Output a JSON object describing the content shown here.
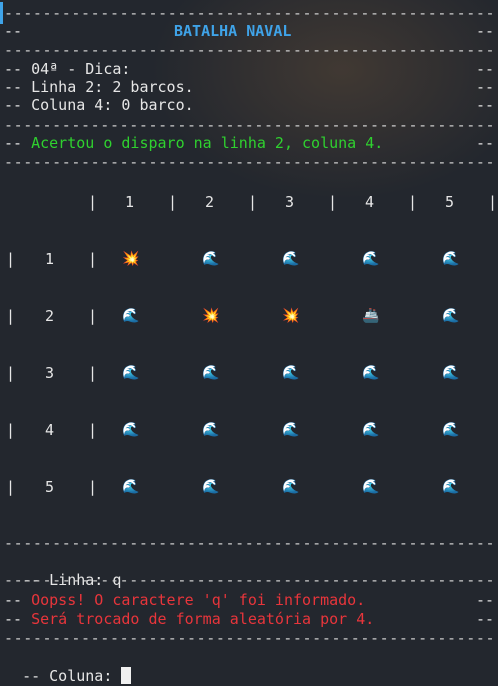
{
  "header": {
    "dash": "--------------------------------------------------------------------",
    "edge": "--",
    "title": "BATALHA NAVAL"
  },
  "hint": {
    "title": "04ª - Dica:",
    "line": "Linha 2: 2 barcos.",
    "column": "Coluna 4: 0 barco."
  },
  "message": "Acertou o disparo na linha 2, coluna 4.",
  "board": {
    "column_headers": [
      "1",
      "2",
      "3",
      "4",
      "5"
    ],
    "rows": [
      {
        "label": "1",
        "cells": [
          "hit",
          "sea",
          "sea",
          "sea",
          "sea"
        ]
      },
      {
        "label": "2",
        "cells": [
          "sea",
          "hit",
          "hit",
          "ship",
          "sea"
        ]
      },
      {
        "label": "3",
        "cells": [
          "sea",
          "sea",
          "sea",
          "sea",
          "sea"
        ]
      },
      {
        "label": "4",
        "cells": [
          "sea",
          "sea",
          "sea",
          "sea",
          "sea"
        ]
      },
      {
        "label": "5",
        "cells": [
          "sea",
          "sea",
          "sea",
          "sea",
          "sea"
        ]
      }
    ],
    "separator": "|"
  },
  "input": {
    "line_prompt": "Linha: q",
    "error_1": "Oopss! O caractere 'q' foi informado.",
    "error_2": "Será trocado de forma aleatória por 4.",
    "column_prompt": "Coluna: "
  },
  "icons": {
    "hit": "explosion-icon",
    "sea": "water-wave-icon",
    "ship": "ship-icon"
  },
  "colors": {
    "title": "#3fa3e8",
    "success": "#2fd12f",
    "error": "#e8353b",
    "background": "#23272e"
  }
}
